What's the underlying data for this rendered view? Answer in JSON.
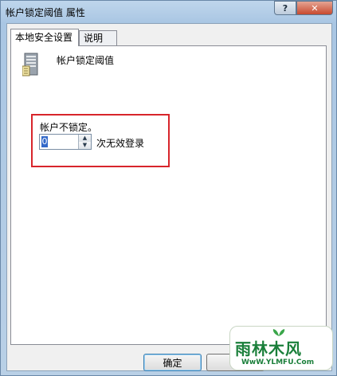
{
  "window": {
    "title": "帐户锁定阈值 属性",
    "help_label": "?",
    "close_label": "✕"
  },
  "tabs": [
    {
      "label": "本地安全设置",
      "active": true
    },
    {
      "label": "说明",
      "active": false
    }
  ],
  "policy": {
    "name": "帐户锁定阈值",
    "icon": "server-icon"
  },
  "setting": {
    "status_label": "帐户不锁定。",
    "value": "0",
    "unit_label": "次无效登录"
  },
  "buttons": {
    "ok_label": "确定",
    "cancel_label": "取"
  },
  "watermark": {
    "main": "雨林木风",
    "sub": "WwW.YLMFU.Com"
  },
  "colors": {
    "highlight_border": "#d8252b",
    "selection": "#3369c9",
    "watermark_green": "#1a7f3a"
  }
}
